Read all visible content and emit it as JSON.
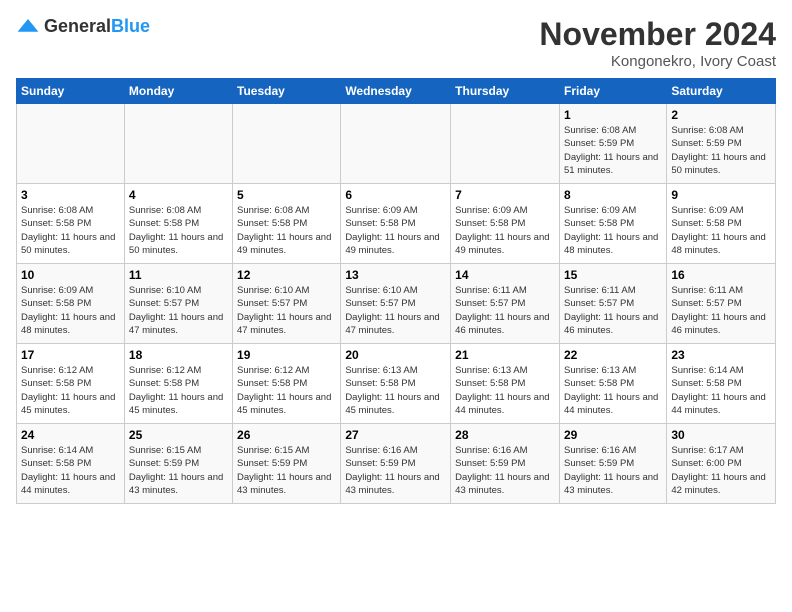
{
  "logo": {
    "general": "General",
    "blue": "Blue"
  },
  "title": "November 2024",
  "location": "Kongonekro, Ivory Coast",
  "days_of_week": [
    "Sunday",
    "Monday",
    "Tuesday",
    "Wednesday",
    "Thursday",
    "Friday",
    "Saturday"
  ],
  "weeks": [
    [
      {
        "day": "",
        "info": ""
      },
      {
        "day": "",
        "info": ""
      },
      {
        "day": "",
        "info": ""
      },
      {
        "day": "",
        "info": ""
      },
      {
        "day": "",
        "info": ""
      },
      {
        "day": "1",
        "info": "Sunrise: 6:08 AM\nSunset: 5:59 PM\nDaylight: 11 hours and 51 minutes."
      },
      {
        "day": "2",
        "info": "Sunrise: 6:08 AM\nSunset: 5:59 PM\nDaylight: 11 hours and 50 minutes."
      }
    ],
    [
      {
        "day": "3",
        "info": "Sunrise: 6:08 AM\nSunset: 5:58 PM\nDaylight: 11 hours and 50 minutes."
      },
      {
        "day": "4",
        "info": "Sunrise: 6:08 AM\nSunset: 5:58 PM\nDaylight: 11 hours and 50 minutes."
      },
      {
        "day": "5",
        "info": "Sunrise: 6:08 AM\nSunset: 5:58 PM\nDaylight: 11 hours and 49 minutes."
      },
      {
        "day": "6",
        "info": "Sunrise: 6:09 AM\nSunset: 5:58 PM\nDaylight: 11 hours and 49 minutes."
      },
      {
        "day": "7",
        "info": "Sunrise: 6:09 AM\nSunset: 5:58 PM\nDaylight: 11 hours and 49 minutes."
      },
      {
        "day": "8",
        "info": "Sunrise: 6:09 AM\nSunset: 5:58 PM\nDaylight: 11 hours and 48 minutes."
      },
      {
        "day": "9",
        "info": "Sunrise: 6:09 AM\nSunset: 5:58 PM\nDaylight: 11 hours and 48 minutes."
      }
    ],
    [
      {
        "day": "10",
        "info": "Sunrise: 6:09 AM\nSunset: 5:58 PM\nDaylight: 11 hours and 48 minutes."
      },
      {
        "day": "11",
        "info": "Sunrise: 6:10 AM\nSunset: 5:57 PM\nDaylight: 11 hours and 47 minutes."
      },
      {
        "day": "12",
        "info": "Sunrise: 6:10 AM\nSunset: 5:57 PM\nDaylight: 11 hours and 47 minutes."
      },
      {
        "day": "13",
        "info": "Sunrise: 6:10 AM\nSunset: 5:57 PM\nDaylight: 11 hours and 47 minutes."
      },
      {
        "day": "14",
        "info": "Sunrise: 6:11 AM\nSunset: 5:57 PM\nDaylight: 11 hours and 46 minutes."
      },
      {
        "day": "15",
        "info": "Sunrise: 6:11 AM\nSunset: 5:57 PM\nDaylight: 11 hours and 46 minutes."
      },
      {
        "day": "16",
        "info": "Sunrise: 6:11 AM\nSunset: 5:57 PM\nDaylight: 11 hours and 46 minutes."
      }
    ],
    [
      {
        "day": "17",
        "info": "Sunrise: 6:12 AM\nSunset: 5:58 PM\nDaylight: 11 hours and 45 minutes."
      },
      {
        "day": "18",
        "info": "Sunrise: 6:12 AM\nSunset: 5:58 PM\nDaylight: 11 hours and 45 minutes."
      },
      {
        "day": "19",
        "info": "Sunrise: 6:12 AM\nSunset: 5:58 PM\nDaylight: 11 hours and 45 minutes."
      },
      {
        "day": "20",
        "info": "Sunrise: 6:13 AM\nSunset: 5:58 PM\nDaylight: 11 hours and 45 minutes."
      },
      {
        "day": "21",
        "info": "Sunrise: 6:13 AM\nSunset: 5:58 PM\nDaylight: 11 hours and 44 minutes."
      },
      {
        "day": "22",
        "info": "Sunrise: 6:13 AM\nSunset: 5:58 PM\nDaylight: 11 hours and 44 minutes."
      },
      {
        "day": "23",
        "info": "Sunrise: 6:14 AM\nSunset: 5:58 PM\nDaylight: 11 hours and 44 minutes."
      }
    ],
    [
      {
        "day": "24",
        "info": "Sunrise: 6:14 AM\nSunset: 5:58 PM\nDaylight: 11 hours and 44 minutes."
      },
      {
        "day": "25",
        "info": "Sunrise: 6:15 AM\nSunset: 5:59 PM\nDaylight: 11 hours and 43 minutes."
      },
      {
        "day": "26",
        "info": "Sunrise: 6:15 AM\nSunset: 5:59 PM\nDaylight: 11 hours and 43 minutes."
      },
      {
        "day": "27",
        "info": "Sunrise: 6:16 AM\nSunset: 5:59 PM\nDaylight: 11 hours and 43 minutes."
      },
      {
        "day": "28",
        "info": "Sunrise: 6:16 AM\nSunset: 5:59 PM\nDaylight: 11 hours and 43 minutes."
      },
      {
        "day": "29",
        "info": "Sunrise: 6:16 AM\nSunset: 5:59 PM\nDaylight: 11 hours and 43 minutes."
      },
      {
        "day": "30",
        "info": "Sunrise: 6:17 AM\nSunset: 6:00 PM\nDaylight: 11 hours and 42 minutes."
      }
    ]
  ]
}
